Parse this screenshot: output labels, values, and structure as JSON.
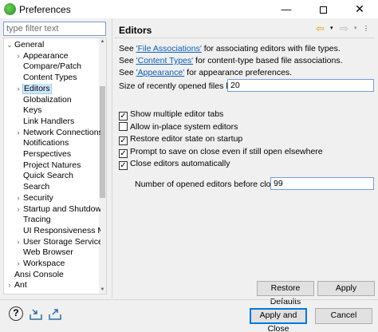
{
  "window": {
    "title": "Preferences",
    "minimize_glyph": "—",
    "close_glyph": "✕"
  },
  "filter": {
    "placeholder": "type filter text",
    "value": ""
  },
  "tree": {
    "items": [
      {
        "label": "General",
        "twisty": "⌄",
        "indent": 0
      },
      {
        "label": "Appearance",
        "twisty": "›",
        "indent": 1
      },
      {
        "label": "Compare/Patch",
        "twisty": "",
        "indent": 1
      },
      {
        "label": "Content Types",
        "twisty": "",
        "indent": 1
      },
      {
        "label": "Editors",
        "twisty": "›",
        "indent": 1,
        "selected": true
      },
      {
        "label": "Globalization",
        "twisty": "",
        "indent": 1
      },
      {
        "label": "Keys",
        "twisty": "",
        "indent": 1
      },
      {
        "label": "Link Handlers",
        "twisty": "",
        "indent": 1
      },
      {
        "label": "Network Connections",
        "twisty": "›",
        "indent": 1
      },
      {
        "label": "Notifications",
        "twisty": "",
        "indent": 1
      },
      {
        "label": "Perspectives",
        "twisty": "",
        "indent": 1
      },
      {
        "label": "Project Natures",
        "twisty": "",
        "indent": 1
      },
      {
        "label": "Quick Search",
        "twisty": "",
        "indent": 1
      },
      {
        "label": "Search",
        "twisty": "",
        "indent": 1
      },
      {
        "label": "Security",
        "twisty": "›",
        "indent": 1
      },
      {
        "label": "Startup and Shutdown",
        "twisty": "›",
        "indent": 1
      },
      {
        "label": "Tracing",
        "twisty": "",
        "indent": 1
      },
      {
        "label": "UI Responsiveness Monitoring",
        "twisty": "",
        "indent": 1
      },
      {
        "label": "User Storage Service",
        "twisty": "›",
        "indent": 1
      },
      {
        "label": "Web Browser",
        "twisty": "",
        "indent": 1
      },
      {
        "label": "Workspace",
        "twisty": "›",
        "indent": 1
      },
      {
        "label": "Ansi Console",
        "twisty": "",
        "indent": 0
      },
      {
        "label": "Ant",
        "twisty": "›",
        "indent": 0
      }
    ]
  },
  "page": {
    "title": "Editors",
    "info": [
      {
        "prefix": "See ",
        "link": "'File Associations'",
        "suffix": " for associating editors with file types."
      },
      {
        "prefix": "See ",
        "link": "'Content Types'",
        "suffix": " for content-type based file associations."
      },
      {
        "prefix": "See ",
        "link": "'Appearance'",
        "suffix": " for appearance preferences."
      }
    ],
    "recent_files": {
      "label": "Size of recently opened files list:",
      "value": "20"
    },
    "checkboxes": [
      {
        "label": "Show multiple editor tabs",
        "checked": true
      },
      {
        "label": "Allow in-place system editors",
        "checked": false
      },
      {
        "label": "Restore editor state on startup",
        "checked": true
      },
      {
        "label": "Prompt to save on close even if still open elsewhere",
        "checked": true
      },
      {
        "label": "Close editors automatically",
        "checked": true
      }
    ],
    "opened_editors": {
      "label": "Number of opened editors before closing:",
      "value": "99"
    }
  },
  "buttons": {
    "restore_defaults": "Restore Defaults",
    "apply": "Apply",
    "apply_and_close": "Apply and Close",
    "cancel": "Cancel"
  },
  "icons": {
    "help": "?",
    "import": "⇲",
    "export": "⇱",
    "back": "⇦",
    "forward": "⇨",
    "dropdown": "▾",
    "view_menu": "⋮",
    "checkmark": "✓"
  },
  "colors": {
    "link": "#0b5fb5",
    "selection": "#cce8ff",
    "primary_border": "#0078d7"
  }
}
